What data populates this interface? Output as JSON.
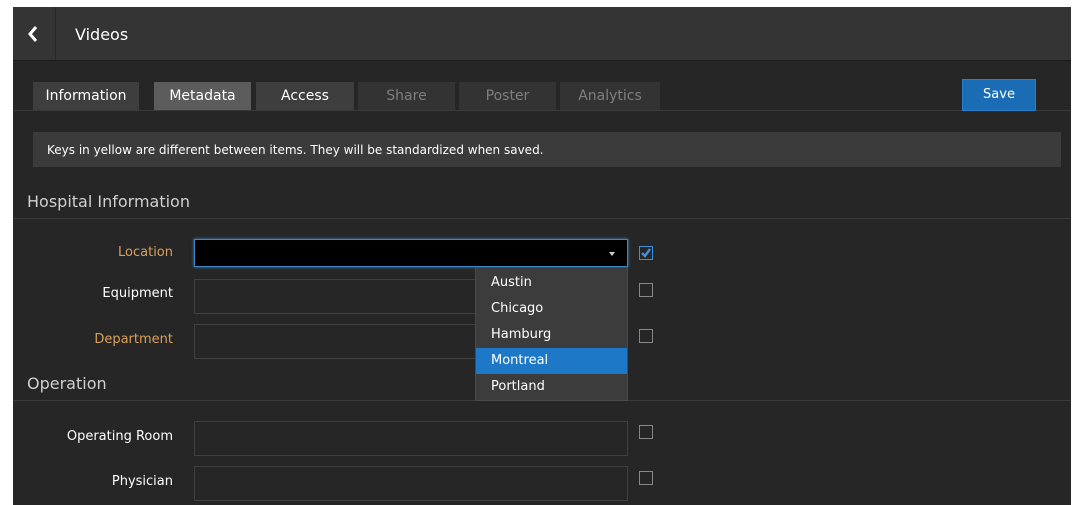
{
  "header": {
    "title": "Videos",
    "back_icon": "chevron-left-icon"
  },
  "tabs": [
    {
      "label": "Information",
      "state": "normal"
    },
    {
      "label": "Metadata",
      "state": "active"
    },
    {
      "label": "Access",
      "state": "normal"
    },
    {
      "label": "Share",
      "state": "disabled"
    },
    {
      "label": "Poster",
      "state": "disabled"
    },
    {
      "label": "Analytics",
      "state": "disabled"
    }
  ],
  "toolbar": {
    "save_label": "Save"
  },
  "notice": "Keys in yellow are different between items. They will be standardized when saved.",
  "sections": {
    "hospital": {
      "title": "Hospital Information",
      "fields": {
        "location": {
          "label": "Location",
          "value": "",
          "checked": true
        },
        "equipment": {
          "label": "Equipment",
          "value": "",
          "checked": false
        },
        "department": {
          "label": "Department",
          "value": "",
          "checked": false
        }
      }
    },
    "operation": {
      "title": "Operation",
      "fields": {
        "operating_room": {
          "label": "Operating Room",
          "value": "",
          "checked": false
        },
        "physician": {
          "label": "Physician",
          "value": "",
          "checked": false
        }
      }
    }
  },
  "location_dropdown": {
    "options": [
      "Austin",
      "Chicago",
      "Hamburg",
      "Montreal",
      "Portland"
    ],
    "highlighted": "Montreal"
  },
  "colors": {
    "accent": "#1a6db5",
    "highlight": "#1e78c8",
    "differs_key": "#d9a05b",
    "background": "#262626"
  }
}
